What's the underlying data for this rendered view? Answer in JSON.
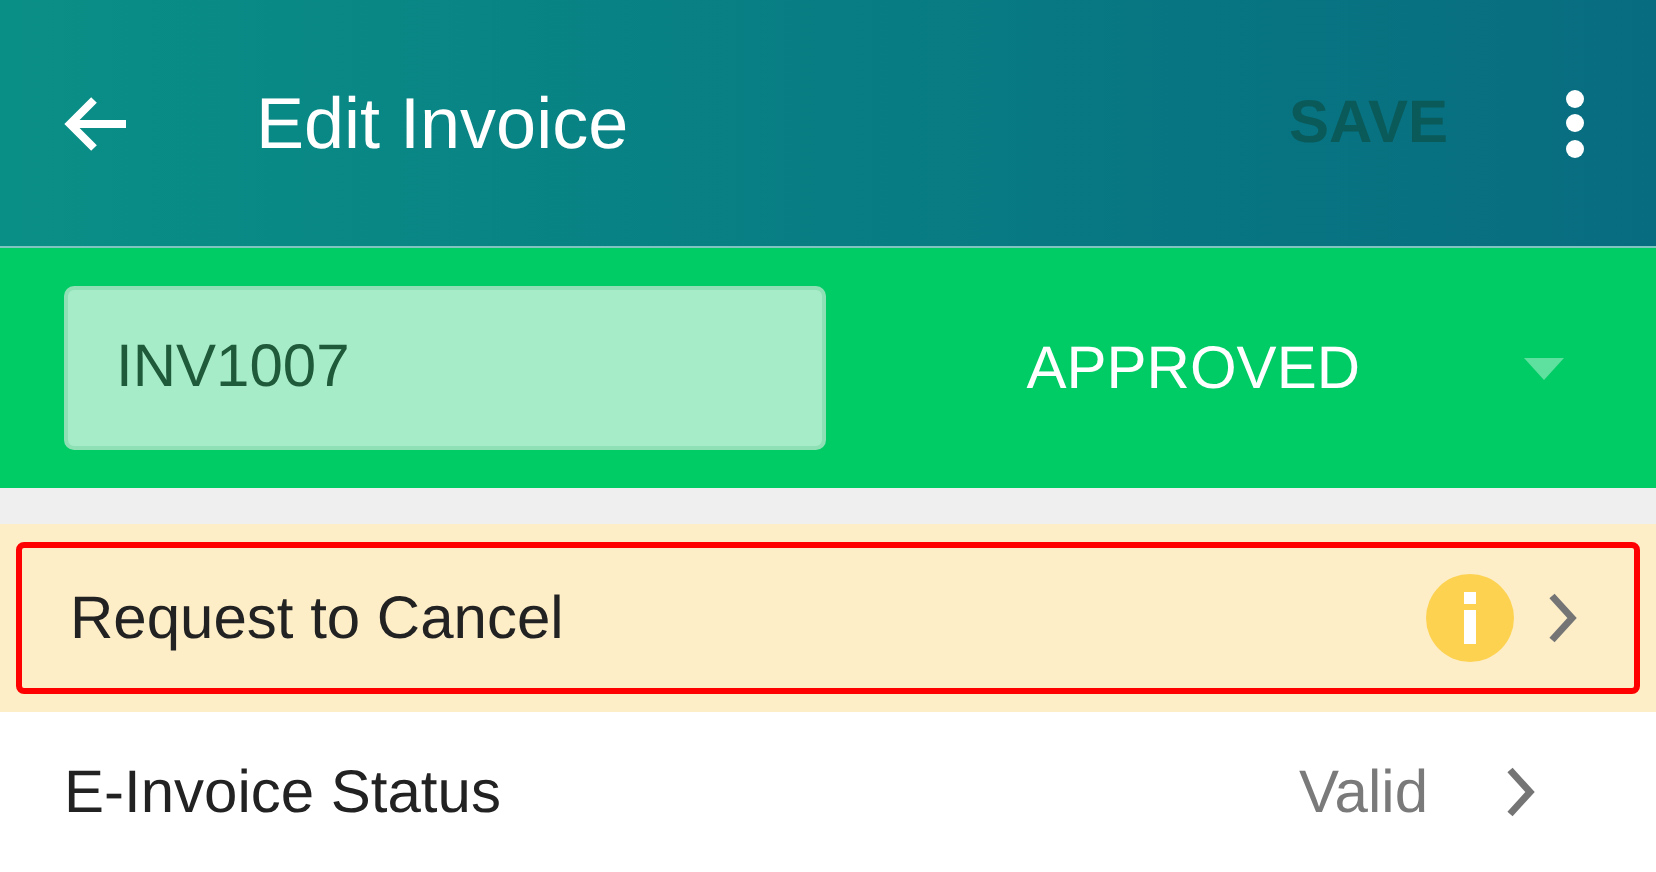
{
  "app_bar": {
    "title": "Edit Invoice",
    "save": {
      "label": "SAVE",
      "disabled": true
    }
  },
  "invoice": {
    "number": "INV1007",
    "status": "APPROVED"
  },
  "rows": [
    {
      "kind": "warning",
      "label": "Request to Cancel",
      "highlighted": true
    },
    {
      "kind": "value",
      "label": "E-Invoice Status",
      "value": "Valid",
      "highlighted": false
    }
  ]
}
